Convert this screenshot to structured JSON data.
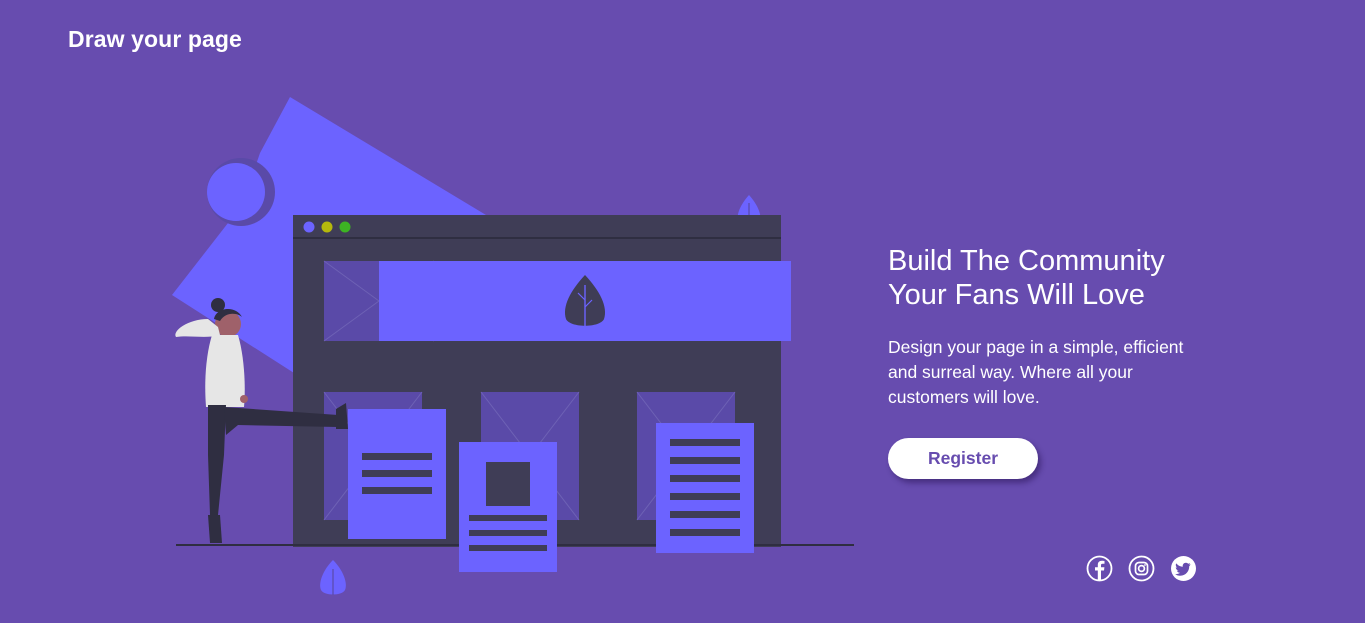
{
  "header": {
    "logo_text": "Draw your page"
  },
  "hero": {
    "title_line1": "Build The Community",
    "title_line2": "Your Fans Will Love",
    "description_line1": "Design your page in a simple, efficient",
    "description_line2": "and surreal way. Where all your",
    "description_line3": "customers will love.",
    "register_label": "Register"
  },
  "socials": {
    "icons": [
      "facebook-icon",
      "instagram-icon",
      "twitter-icon"
    ]
  },
  "colors": {
    "background": "#674caf",
    "accent": "#6c63ff",
    "dark": "#3f3d56",
    "text": "#ffffff"
  }
}
